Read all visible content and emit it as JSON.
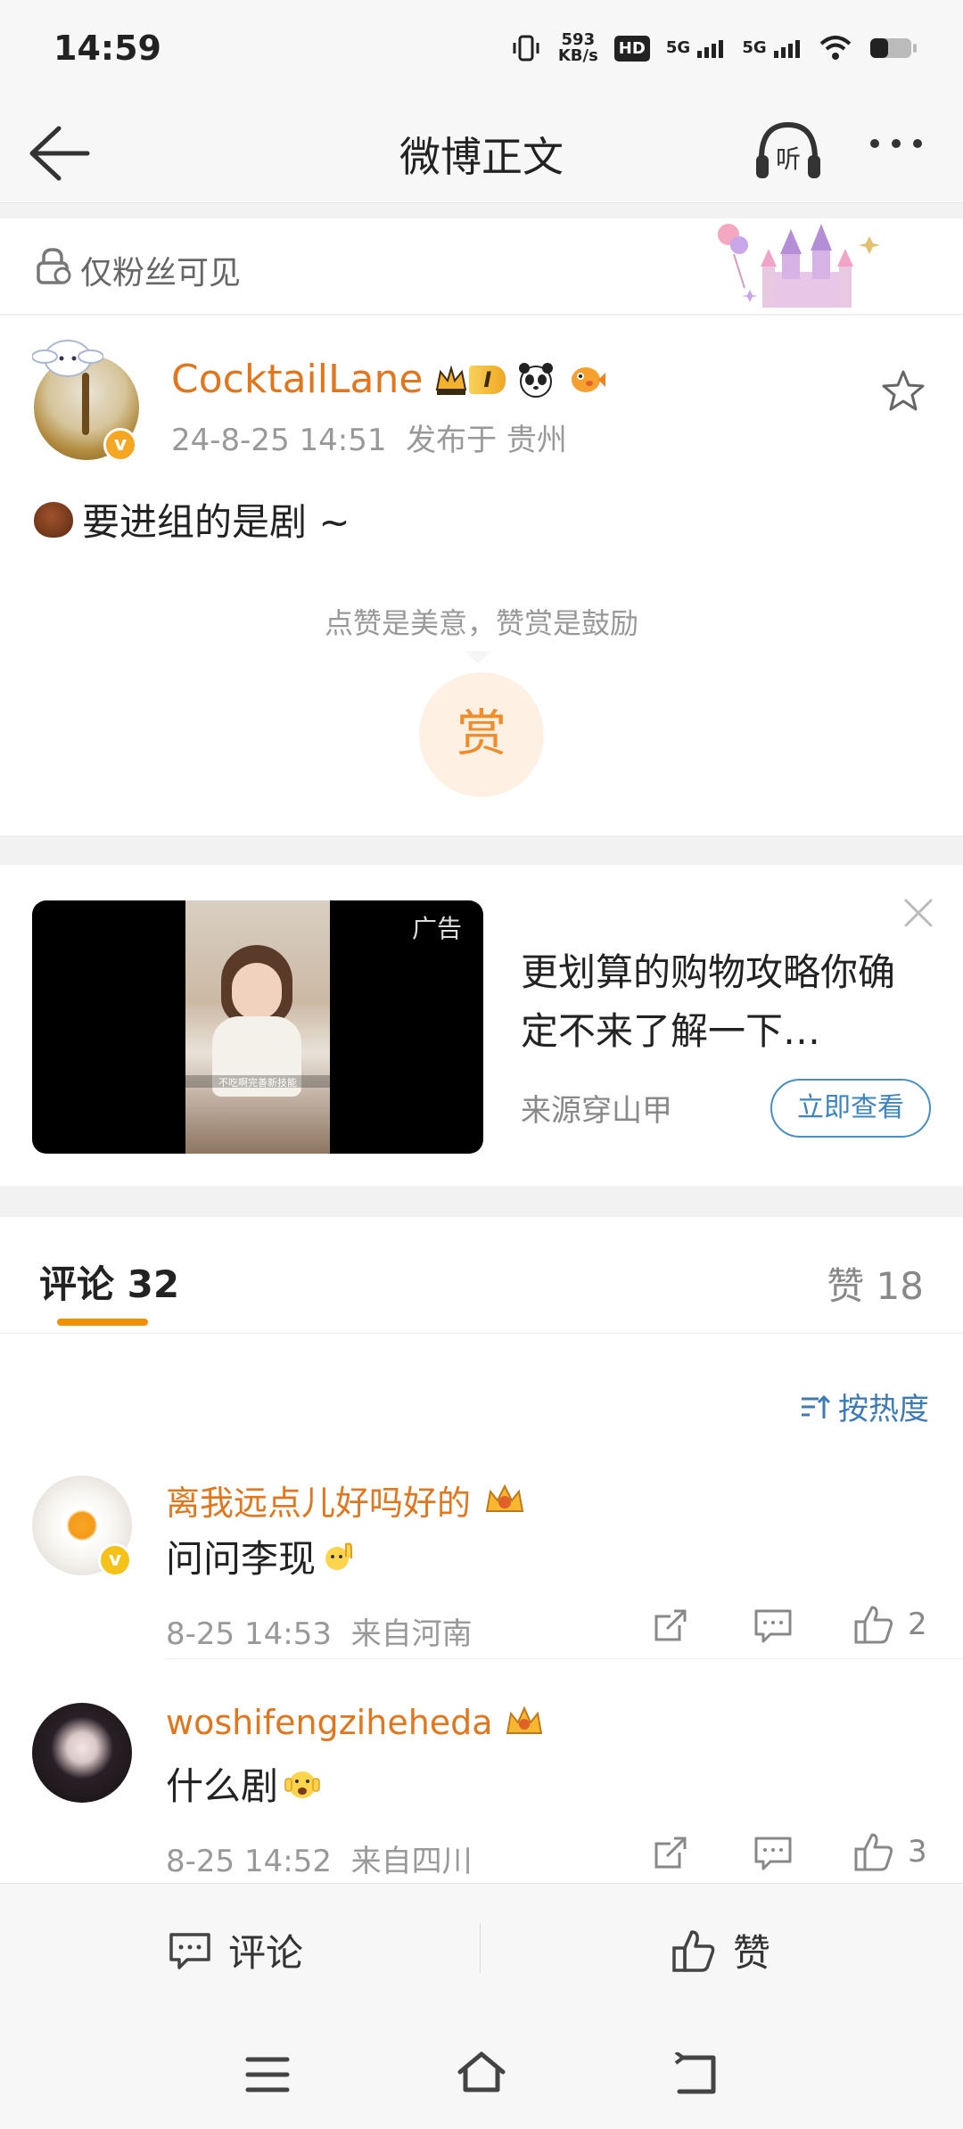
{
  "status_bar": {
    "time": "14:59",
    "net_speed_value": "593",
    "net_speed_unit": "KB/s",
    "hd_label": "HD",
    "sim1": "5G",
    "sim2": "5G"
  },
  "nav": {
    "title": "微博正文",
    "listen_label": "听"
  },
  "visibility": {
    "label": "仅粉丝可见"
  },
  "post": {
    "author": "CocktailLane",
    "level_badge": "I",
    "verified_badge": "v",
    "timestamp": "24-8-25 14:51",
    "location": "发布于 贵州",
    "text": "要进组的是剧 ~",
    "reward_hint": "点赞是美意，赞赏是鼓励",
    "reward_button": "赏"
  },
  "ad": {
    "tag": "广告",
    "title": "更划算的购物攻略你确定不来了解一下…",
    "source": "来源穿山甲",
    "cta": "立即查看",
    "video_caption": "不吃啊完善新技能"
  },
  "comments_section": {
    "tab_comments": "评论 32",
    "tab_likes": "赞 18",
    "sort_label": "按热度",
    "items": [
      {
        "name": "离我远点儿好吗好的",
        "verified_badge": "v",
        "text": "问问李现",
        "timestamp": "8-25 14:53",
        "location": "来自河南",
        "likes": "2"
      },
      {
        "name": "woshifengziheheda",
        "text": "什么剧",
        "timestamp": "8-25 14:52",
        "location": "来自四川",
        "likes": "3"
      }
    ]
  },
  "bottom_bar": {
    "comment_label": "评论",
    "like_label": "赞"
  }
}
